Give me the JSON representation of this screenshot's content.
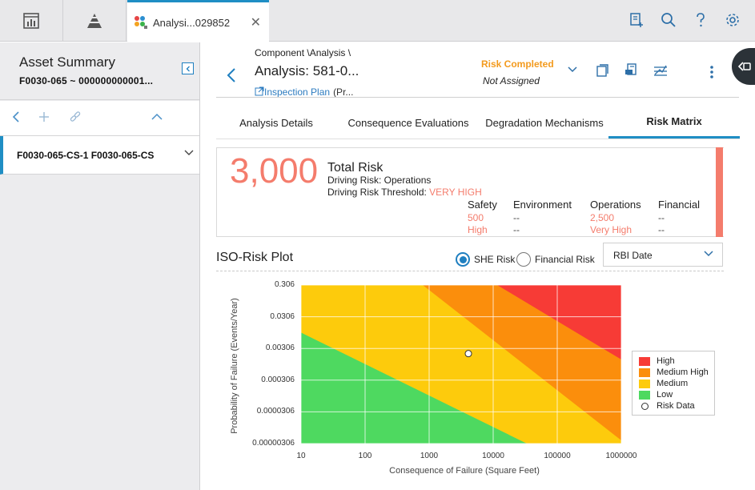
{
  "topbar": {
    "tab_label": "Analysi...029852",
    "tab_close": "✕"
  },
  "left_panel": {
    "title": "Asset Summary",
    "subtitle": "F0030-065 ~ 000000000001...",
    "node_label": "F0030-065-CS-1 F0030-065-CS"
  },
  "header": {
    "breadcrumb": "Component \\Analysis \\",
    "title": "Analysis: 581-0...",
    "inspection_link": "Inspection Plan",
    "inspection_suffix": "(Pr...",
    "status": "Risk Completed",
    "assignment": "Not Assigned"
  },
  "tabs": [
    {
      "label": "Analysis Details"
    },
    {
      "label": "Consequence Evaluations"
    },
    {
      "label": "Degradation Mechanisms"
    },
    {
      "label": "Risk Matrix",
      "active": true
    }
  ],
  "risk_summary": {
    "total_value": "3,000",
    "total_label": "Total Risk",
    "driving_risk": "Driving Risk: Operations",
    "threshold_label": "Driving Risk Threshold:",
    "threshold_value": "VERY HIGH",
    "categories": [
      {
        "name": "Safety",
        "value": "500",
        "level": "High"
      },
      {
        "name": "Environment",
        "value": "--",
        "level": "--"
      },
      {
        "name": "Operations",
        "value": "2,500",
        "level": "Very High"
      },
      {
        "name": "Financial",
        "value": "--",
        "level": "--"
      }
    ],
    "accent_color": "#f47c6c"
  },
  "iso_plot": {
    "title": "ISO-Risk Plot",
    "radio_she": "SHE Risk",
    "radio_financial": "Financial Risk",
    "selected": "SHE Risk",
    "date_select": "RBI Date"
  },
  "chart_data": {
    "type": "area",
    "xlabel": "Consequence of Failure (Square Feet)",
    "ylabel": "Probability of Failure (Events/Year)",
    "x_scale": "log",
    "y_scale": "log",
    "xlim": [
      10,
      1000000
    ],
    "ylim": [
      3.06e-05,
      0.306
    ],
    "x_ticks": [
      "10",
      "100",
      "1000",
      "10000",
      "100000",
      "1000000"
    ],
    "y_ticks": [
      "0.306",
      "0.0306",
      "0.00306",
      "0.000306",
      "0.0000306",
      "0.00000306"
    ],
    "grid": true,
    "legend_position": "right",
    "regions": [
      {
        "name": "High",
        "color": "#f73b36"
      },
      {
        "name": "Medium High",
        "color": "#fb8e0c"
      },
      {
        "name": "Medium",
        "color": "#fdcb0c"
      },
      {
        "name": "Low",
        "color": "#4ed960"
      }
    ],
    "series": [
      {
        "name": "Risk Data",
        "x": [
          4100
        ],
        "y": [
          0.0021
        ]
      }
    ],
    "legend": [
      "High",
      "Medium High",
      "Medium",
      "Low",
      "Risk Data"
    ]
  }
}
